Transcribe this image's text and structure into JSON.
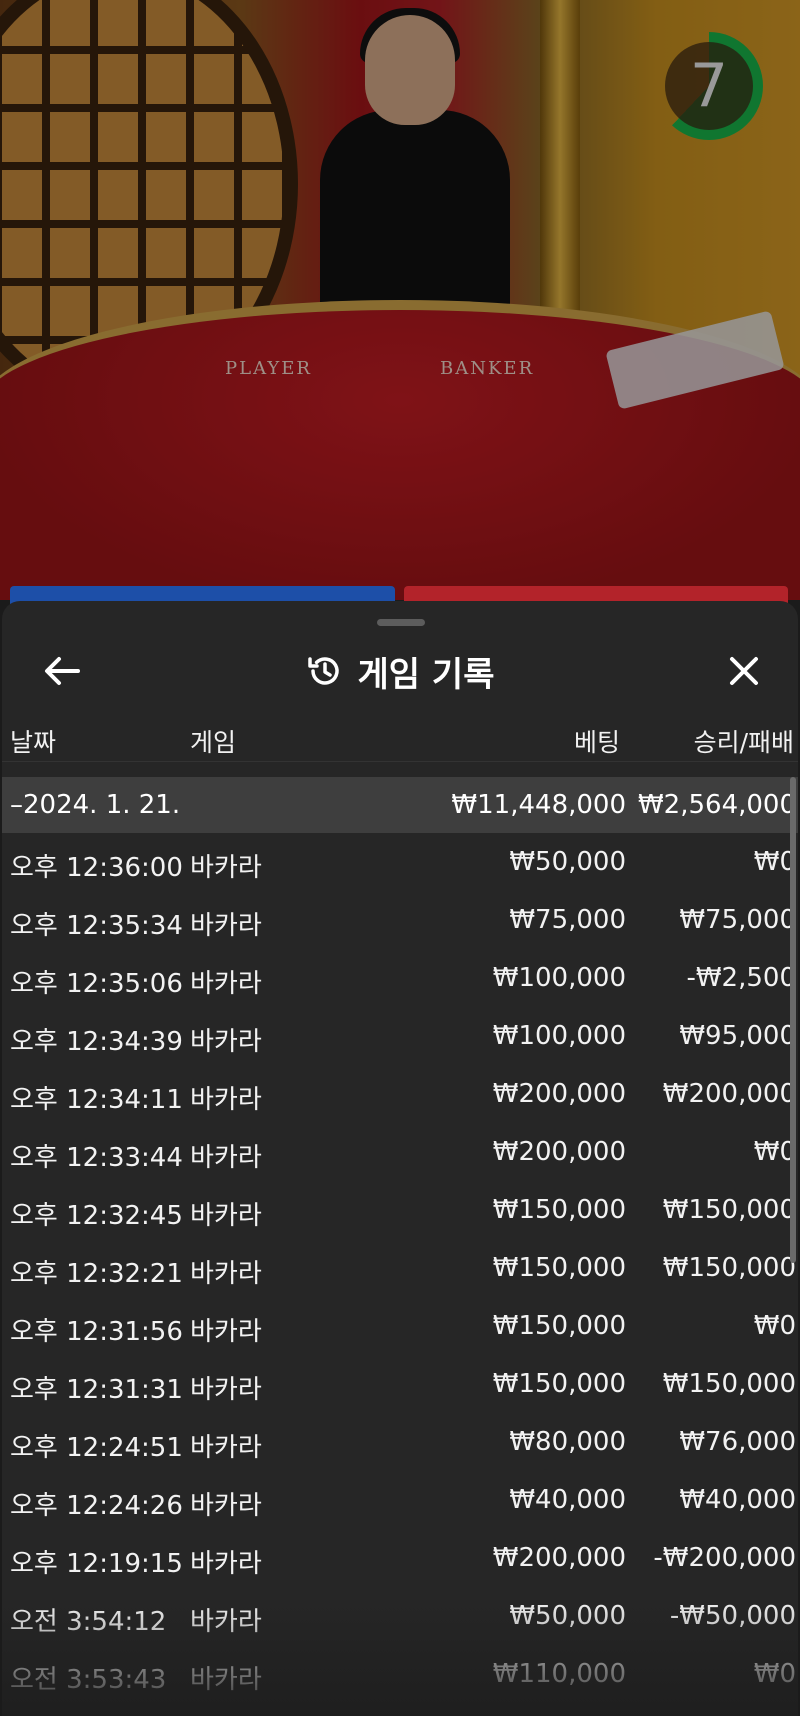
{
  "video": {
    "table_labels": [
      "PLAYER",
      "BANKER"
    ],
    "countdown": "7",
    "colors": {
      "timer_ring": "#19b64a",
      "player_blue": "#1d4fa8",
      "banker_red": "#b3232a"
    }
  },
  "sheet": {
    "title": "게임 기록",
    "icons": {
      "back": "arrow-left-icon",
      "history": "history-icon",
      "close": "close-icon"
    },
    "columns": {
      "date": "날짜",
      "game": "게임",
      "bet": "베팅",
      "result": "승리/패배"
    },
    "group": {
      "label": "–2024. 1. 21.",
      "bet_total": "₩11,448,000",
      "result_total": "₩2,564,000"
    },
    "rows": [
      {
        "time": "오후 12:36:00",
        "game": "바카라",
        "bet": "₩50,000",
        "result": "₩0"
      },
      {
        "time": "오후 12:35:34",
        "game": "바카라",
        "bet": "₩75,000",
        "result": "₩75,000"
      },
      {
        "time": "오후 12:35:06",
        "game": "바카라",
        "bet": "₩100,000",
        "result": "-₩2,500"
      },
      {
        "time": "오후 12:34:39",
        "game": "바카라",
        "bet": "₩100,000",
        "result": "₩95,000"
      },
      {
        "time": "오후 12:34:11",
        "game": "바카라",
        "bet": "₩200,000",
        "result": "₩200,000"
      },
      {
        "time": "오후 12:33:44",
        "game": "바카라",
        "bet": "₩200,000",
        "result": "₩0"
      },
      {
        "time": "오후 12:32:45",
        "game": "바카라",
        "bet": "₩150,000",
        "result": "₩150,000"
      },
      {
        "time": "오후 12:32:21",
        "game": "바카라",
        "bet": "₩150,000",
        "result": "₩150,000"
      },
      {
        "time": "오후 12:31:56",
        "game": "바카라",
        "bet": "₩150,000",
        "result": "₩0"
      },
      {
        "time": "오후 12:31:31",
        "game": "바카라",
        "bet": "₩150,000",
        "result": "₩150,000"
      },
      {
        "time": "오후 12:24:51",
        "game": "바카라",
        "bet": "₩80,000",
        "result": "₩76,000"
      },
      {
        "time": "오후 12:24:26",
        "game": "바카라",
        "bet": "₩40,000",
        "result": "₩40,000"
      },
      {
        "time": "오후 12:19:15",
        "game": "바카라",
        "bet": "₩200,000",
        "result": "-₩200,000"
      },
      {
        "time": "오전 3:54:12",
        "game": "바카라",
        "bet": "₩50,000",
        "result": "-₩50,000"
      },
      {
        "time": "오전 3:53:43",
        "game": "바카라",
        "bet": "₩110,000",
        "result": "₩0"
      }
    ]
  }
}
